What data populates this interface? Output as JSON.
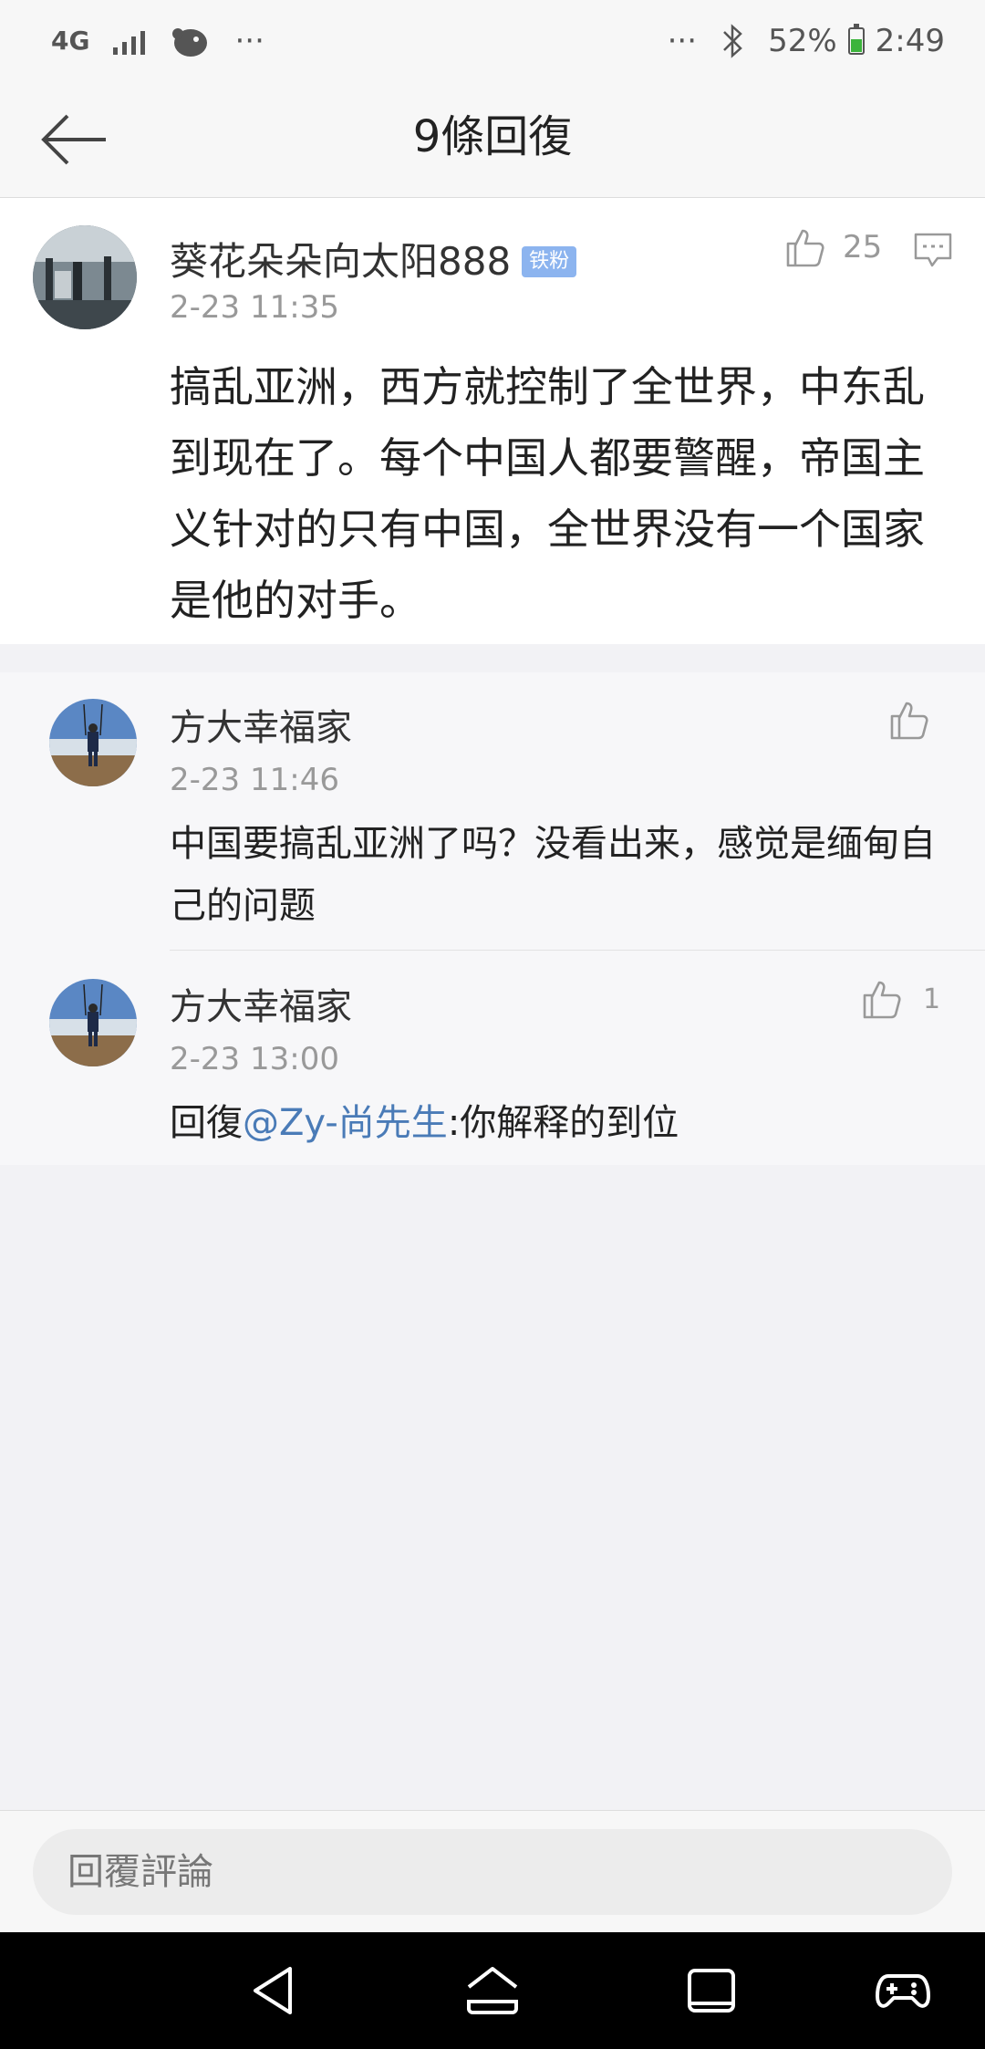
{
  "status_bar": {
    "network": "4G",
    "more_left": "···",
    "more_right": "···",
    "battery_percent": "52%",
    "battery_level": 0.52,
    "time": "2:49"
  },
  "header": {
    "title": "9條回復",
    "back_icon": "arrow-left-icon"
  },
  "main_comment": {
    "author": "葵花朵朵向太阳888",
    "badge": "铁粉",
    "time": "2-23 11:35",
    "likes": "25",
    "text": "搞乱亚洲，西方就控制了全世界，中东乱到现在了。每个中国人都要警醒，帝国主义针对的只有中国，全世界没有一个国家是他的对手。"
  },
  "replies": [
    {
      "author": "方大幸福家",
      "time": "2-23 11:46",
      "likes": "",
      "text": "中国要搞乱亚洲了吗？没看出来，感觉是缅甸自己的问题"
    },
    {
      "author": "方大幸福家",
      "time": "2-23 13:00",
      "likes": "1",
      "prefix": "回復",
      "mention": "@Zy-尚先生",
      "text": ":你解释的到位"
    }
  ],
  "bottom": {
    "reply_placeholder": "回覆評論"
  },
  "colors": {
    "mention": "#4a7bb7",
    "badge": "#8cb4ef",
    "battery": "#3cb43c"
  }
}
